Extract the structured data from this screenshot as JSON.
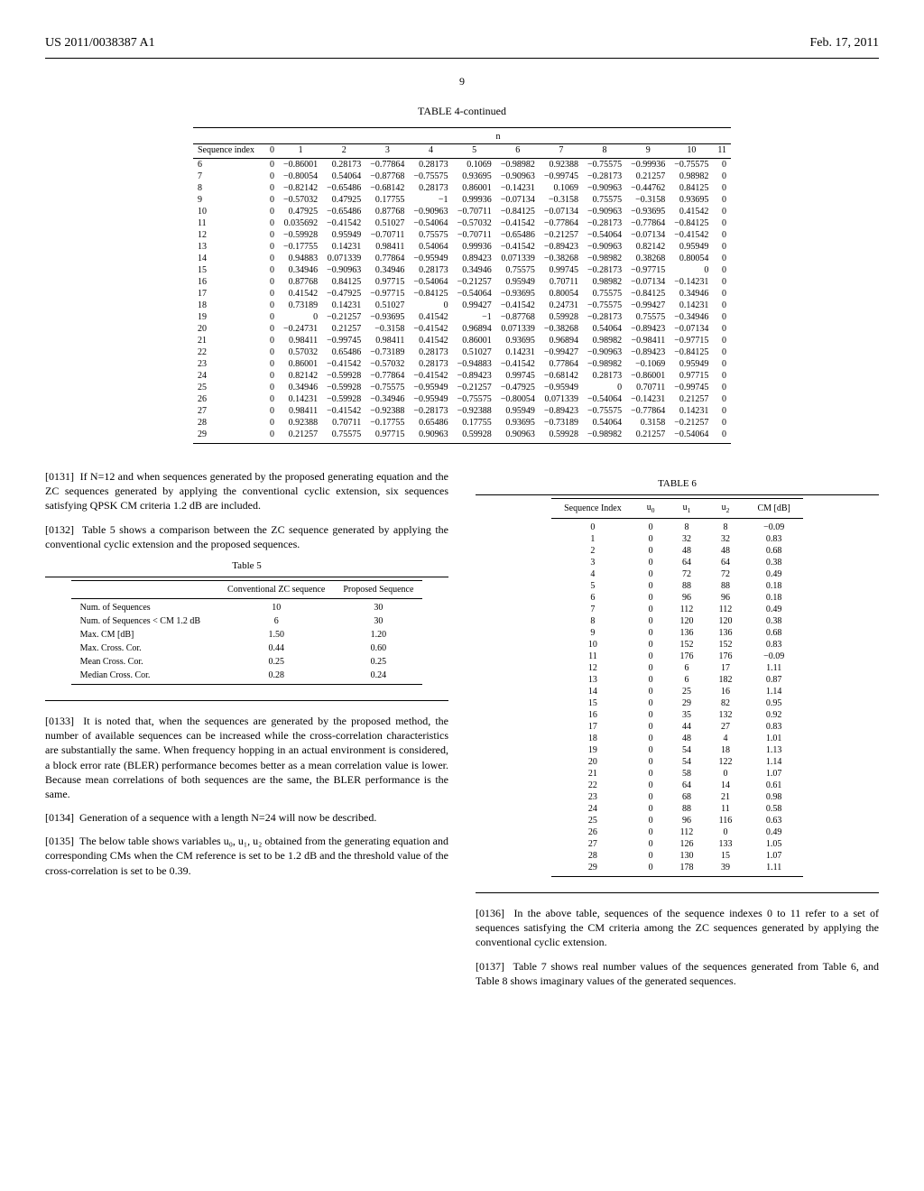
{
  "header": {
    "pub_no": "US 2011/0038387 A1",
    "date": "Feb. 17, 2011"
  },
  "page_number": "9",
  "table4": {
    "title": "TABLE 4-continued",
    "n_label": "n",
    "seq_label": "Sequence index",
    "cols": [
      "0",
      "1",
      "2",
      "3",
      "4",
      "5",
      "6",
      "7",
      "8",
      "9",
      "10",
      "11"
    ],
    "rows": [
      {
        "idx": "6",
        "v": [
          "0",
          "−0.86001",
          "0.28173",
          "−0.77864",
          "0.28173",
          "0.1069",
          "−0.98982",
          "0.92388",
          "−0.75575",
          "−0.99936",
          "−0.75575",
          "0"
        ]
      },
      {
        "idx": "7",
        "v": [
          "0",
          "−0.80054",
          "0.54064",
          "−0.87768",
          "−0.75575",
          "0.93695",
          "−0.90963",
          "−0.99745",
          "−0.28173",
          "0.21257",
          "0.98982",
          "0"
        ]
      },
      {
        "idx": "8",
        "v": [
          "0",
          "−0.82142",
          "−0.65486",
          "−0.68142",
          "0.28173",
          "0.86001",
          "−0.14231",
          "0.1069",
          "−0.90963",
          "−0.44762",
          "0.84125",
          "0"
        ]
      },
      {
        "idx": "9",
        "v": [
          "0",
          "−0.57032",
          "0.47925",
          "0.17755",
          "−1",
          "0.99936",
          "−0.07134",
          "−0.3158",
          "0.75575",
          "−0.3158",
          "0.93695",
          "0"
        ]
      },
      {
        "idx": "10",
        "v": [
          "0",
          "0.47925",
          "−0.65486",
          "0.87768",
          "−0.90963",
          "−0.70711",
          "−0.84125",
          "−0.07134",
          "−0.90963",
          "−0.93695",
          "0.41542",
          "0"
        ]
      },
      {
        "idx": "11",
        "v": [
          "0",
          "0.035692",
          "−0.41542",
          "0.51027",
          "−0.54064",
          "−0.57032",
          "−0.41542",
          "−0.77864",
          "−0.28173",
          "−0.77864",
          "−0.84125",
          "0"
        ]
      },
      {
        "idx": "12",
        "v": [
          "0",
          "−0.59928",
          "0.95949",
          "−0.70711",
          "0.75575",
          "−0.70711",
          "−0.65486",
          "−0.21257",
          "−0.54064",
          "−0.07134",
          "−0.41542",
          "0"
        ]
      },
      {
        "idx": "13",
        "v": [
          "0",
          "−0.17755",
          "0.14231",
          "0.98411",
          "0.54064",
          "0.99936",
          "−0.41542",
          "−0.89423",
          "−0.90963",
          "0.82142",
          "0.95949",
          "0"
        ]
      },
      {
        "idx": "14",
        "v": [
          "0",
          "0.94883",
          "0.071339",
          "0.77864",
          "−0.95949",
          "0.89423",
          "0.071339",
          "−0.38268",
          "−0.98982",
          "0.38268",
          "0.80054",
          "0"
        ]
      },
      {
        "idx": "15",
        "v": [
          "0",
          "0.34946",
          "−0.90963",
          "0.34946",
          "0.28173",
          "0.34946",
          "0.75575",
          "0.99745",
          "−0.28173",
          "−0.97715",
          "0",
          "0"
        ]
      },
      {
        "idx": "16",
        "v": [
          "0",
          "0.87768",
          "0.84125",
          "0.97715",
          "−0.54064",
          "−0.21257",
          "0.95949",
          "0.70711",
          "0.98982",
          "−0.07134",
          "−0.14231",
          "0"
        ]
      },
      {
        "idx": "17",
        "v": [
          "0",
          "0.41542",
          "−0.47925",
          "−0.97715",
          "−0.84125",
          "−0.54064",
          "−0.93695",
          "0.80054",
          "0.75575",
          "−0.84125",
          "0.34946",
          "0"
        ]
      },
      {
        "idx": "18",
        "v": [
          "0",
          "0.73189",
          "0.14231",
          "0.51027",
          "0",
          "0.99427",
          "−0.41542",
          "0.24731",
          "−0.75575",
          "−0.99427",
          "0.14231",
          "0"
        ]
      },
      {
        "idx": "19",
        "v": [
          "0",
          "0",
          "−0.21257",
          "−0.93695",
          "0.41542",
          "−1",
          "−0.87768",
          "0.59928",
          "−0.28173",
          "0.75575",
          "−0.34946",
          "0"
        ]
      },
      {
        "idx": "20",
        "v": [
          "0",
          "−0.24731",
          "0.21257",
          "−0.3158",
          "−0.41542",
          "0.96894",
          "0.071339",
          "−0.38268",
          "0.54064",
          "−0.89423",
          "−0.07134",
          "0"
        ]
      },
      {
        "idx": "21",
        "v": [
          "0",
          "0.98411",
          "−0.99745",
          "0.98411",
          "0.41542",
          "0.86001",
          "0.93695",
          "0.96894",
          "0.98982",
          "−0.98411",
          "−0.97715",
          "0"
        ]
      },
      {
        "idx": "22",
        "v": [
          "0",
          "0.57032",
          "0.65486",
          "−0.73189",
          "0.28173",
          "0.51027",
          "0.14231",
          "−0.99427",
          "−0.90963",
          "−0.89423",
          "−0.84125",
          "0"
        ]
      },
      {
        "idx": "23",
        "v": [
          "0",
          "0.86001",
          "−0.41542",
          "−0.57032",
          "0.28173",
          "−0.94883",
          "−0.41542",
          "0.77864",
          "−0.98982",
          "−0.1069",
          "0.95949",
          "0"
        ]
      },
      {
        "idx": "24",
        "v": [
          "0",
          "0.82142",
          "−0.59928",
          "−0.77864",
          "−0.41542",
          "−0.89423",
          "0.99745",
          "−0.68142",
          "0.28173",
          "−0.86001",
          "0.97715",
          "0"
        ]
      },
      {
        "idx": "25",
        "v": [
          "0",
          "0.34946",
          "−0.59928",
          "−0.75575",
          "−0.95949",
          "−0.21257",
          "−0.47925",
          "−0.95949",
          "0",
          "0.70711",
          "−0.99745",
          "0"
        ]
      },
      {
        "idx": "26",
        "v": [
          "0",
          "0.14231",
          "−0.59928",
          "−0.34946",
          "−0.95949",
          "−0.75575",
          "−0.80054",
          "0.071339",
          "−0.54064",
          "−0.14231",
          "0.21257",
          "0"
        ]
      },
      {
        "idx": "27",
        "v": [
          "0",
          "0.98411",
          "−0.41542",
          "−0.92388",
          "−0.28173",
          "−0.92388",
          "0.95949",
          "−0.89423",
          "−0.75575",
          "−0.77864",
          "0.14231",
          "0"
        ]
      },
      {
        "idx": "28",
        "v": [
          "0",
          "0.92388",
          "0.70711",
          "−0.17755",
          "0.65486",
          "0.17755",
          "0.93695",
          "−0.73189",
          "0.54064",
          "0.3158",
          "−0.21257",
          "0"
        ]
      },
      {
        "idx": "29",
        "v": [
          "0",
          "0.21257",
          "0.75575",
          "0.97715",
          "0.90963",
          "0.59928",
          "0.90963",
          "0.59928",
          "−0.98982",
          "0.21257",
          "−0.54064",
          "0"
        ]
      }
    ]
  },
  "paragraphs": {
    "p0131": "If N=12 and when sequences generated by the proposed generating equation and the ZC sequences generated by applying the conventional cyclic extension, six sequences satisfying QPSK CM criteria 1.2 dB are included.",
    "p0132": "Table 5 shows a comparison between the ZC sequence generated by applying the conventional cyclic extension and the proposed sequences.",
    "p0133": "It is noted that, when the sequences are generated by the proposed method, the number of available sequences can be increased while the cross-correlation characteristics are substantially the same. When frequency hopping in an actual environment is considered, a block error rate (BLER) performance becomes better as a mean correlation value is lower. Because mean correlations of both sequences are the same, the BLER performance is the same.",
    "p0134": "Generation of a sequence with a length N=24 will now be described.",
    "p0135": "The below table shows variables u₀, u₁, u₂ obtained from the generating equation and corresponding CMs when the CM reference is set to be 1.2 dB and the threshold value of the cross-correlation is set to be 0.39.",
    "p0136": "In the above table, sequences of the sequence indexes 0 to 11 refer to a set of sequences satisfying the CM criteria among the ZC sequences generated by applying the conventional cyclic extension.",
    "p0137": "Table 7 shows real number values of the sequences generated from Table 6, and Table 8 shows imaginary values of the generated sequences."
  },
  "table5": {
    "title": "Table 5",
    "head_blank": "",
    "head_conv": "Conventional ZC sequence",
    "head_prop": "Proposed Sequence",
    "rows": [
      {
        "label": "Num. of Sequences",
        "c": "10",
        "p": "30"
      },
      {
        "label": "Num. of Sequences < CM 1.2 dB",
        "c": "6",
        "p": "30"
      },
      {
        "label": "Max. CM [dB]",
        "c": "1.50",
        "p": "1.20"
      },
      {
        "label": "Max. Cross. Cor.",
        "c": "0.44",
        "p": "0.60"
      },
      {
        "label": "Mean Cross. Cor.",
        "c": "0.25",
        "p": "0.25"
      },
      {
        "label": "Median Cross. Cor.",
        "c": "0.28",
        "p": "0.24"
      }
    ]
  },
  "table6": {
    "title": "TABLE 6",
    "head_idx": "Sequence Index",
    "head_cm": "CM [dB]",
    "rows": [
      {
        "i": "0",
        "u0": "0",
        "u1": "8",
        "u2": "8",
        "cm": "−0.09"
      },
      {
        "i": "1",
        "u0": "0",
        "u1": "32",
        "u2": "32",
        "cm": "0.83"
      },
      {
        "i": "2",
        "u0": "0",
        "u1": "48",
        "u2": "48",
        "cm": "0.68"
      },
      {
        "i": "3",
        "u0": "0",
        "u1": "64",
        "u2": "64",
        "cm": "0.38"
      },
      {
        "i": "4",
        "u0": "0",
        "u1": "72",
        "u2": "72",
        "cm": "0.49"
      },
      {
        "i": "5",
        "u0": "0",
        "u1": "88",
        "u2": "88",
        "cm": "0.18"
      },
      {
        "i": "6",
        "u0": "0",
        "u1": "96",
        "u2": "96",
        "cm": "0.18"
      },
      {
        "i": "7",
        "u0": "0",
        "u1": "112",
        "u2": "112",
        "cm": "0.49"
      },
      {
        "i": "8",
        "u0": "0",
        "u1": "120",
        "u2": "120",
        "cm": "0.38"
      },
      {
        "i": "9",
        "u0": "0",
        "u1": "136",
        "u2": "136",
        "cm": "0.68"
      },
      {
        "i": "10",
        "u0": "0",
        "u1": "152",
        "u2": "152",
        "cm": "0.83"
      },
      {
        "i": "11",
        "u0": "0",
        "u1": "176",
        "u2": "176",
        "cm": "−0.09"
      },
      {
        "i": "12",
        "u0": "0",
        "u1": "6",
        "u2": "17",
        "cm": "1.11"
      },
      {
        "i": "13",
        "u0": "0",
        "u1": "6",
        "u2": "182",
        "cm": "0.87"
      },
      {
        "i": "14",
        "u0": "0",
        "u1": "25",
        "u2": "16",
        "cm": "1.14"
      },
      {
        "i": "15",
        "u0": "0",
        "u1": "29",
        "u2": "82",
        "cm": "0.95"
      },
      {
        "i": "16",
        "u0": "0",
        "u1": "35",
        "u2": "132",
        "cm": "0.92"
      },
      {
        "i": "17",
        "u0": "0",
        "u1": "44",
        "u2": "27",
        "cm": "0.83"
      },
      {
        "i": "18",
        "u0": "0",
        "u1": "48",
        "u2": "4",
        "cm": "1.01"
      },
      {
        "i": "19",
        "u0": "0",
        "u1": "54",
        "u2": "18",
        "cm": "1.13"
      },
      {
        "i": "20",
        "u0": "0",
        "u1": "54",
        "u2": "122",
        "cm": "1.14"
      },
      {
        "i": "21",
        "u0": "0",
        "u1": "58",
        "u2": "0",
        "cm": "1.07"
      },
      {
        "i": "22",
        "u0": "0",
        "u1": "64",
        "u2": "14",
        "cm": "0.61"
      },
      {
        "i": "23",
        "u0": "0",
        "u1": "68",
        "u2": "21",
        "cm": "0.98"
      },
      {
        "i": "24",
        "u0": "0",
        "u1": "88",
        "u2": "11",
        "cm": "0.58"
      },
      {
        "i": "25",
        "u0": "0",
        "u1": "96",
        "u2": "116",
        "cm": "0.63"
      },
      {
        "i": "26",
        "u0": "0",
        "u1": "112",
        "u2": "0",
        "cm": "0.49"
      },
      {
        "i": "27",
        "u0": "0",
        "u1": "126",
        "u2": "133",
        "cm": "1.05"
      },
      {
        "i": "28",
        "u0": "0",
        "u1": "130",
        "u2": "15",
        "cm": "1.07"
      },
      {
        "i": "29",
        "u0": "0",
        "u1": "178",
        "u2": "39",
        "cm": "1.11"
      }
    ]
  }
}
